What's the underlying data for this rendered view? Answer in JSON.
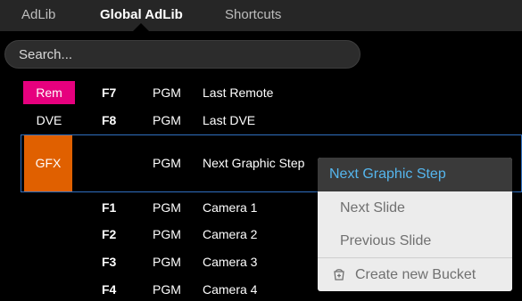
{
  "tabs": [
    {
      "label": "AdLib",
      "active": false
    },
    {
      "label": "Global AdLib",
      "active": true
    },
    {
      "label": "Shortcuts",
      "active": false
    }
  ],
  "search": {
    "placeholder": "Search...",
    "value": ""
  },
  "rows": [
    {
      "tag": "Rem",
      "tag_color": "#e6007e",
      "hotkey": "F7",
      "source": "PGM",
      "name": "Last Remote"
    },
    {
      "tag": "DVE",
      "tag_color": "",
      "hotkey": "F8",
      "source": "PGM",
      "name": "Last DVE"
    },
    {
      "tag": "GFX",
      "tag_color": "#e06000",
      "hotkey": "",
      "source": "PGM",
      "name": "Next Graphic Step",
      "selected": true
    },
    {
      "tag": "",
      "tag_color": "",
      "hotkey": "F1",
      "source": "PGM",
      "name": "Camera 1"
    },
    {
      "tag": "",
      "tag_color": "",
      "hotkey": "F2",
      "source": "PGM",
      "name": "Camera 2"
    },
    {
      "tag": "",
      "tag_color": "",
      "hotkey": "F3",
      "source": "PGM",
      "name": "Camera 3"
    },
    {
      "tag": "",
      "tag_color": "",
      "hotkey": "F4",
      "source": "PGM",
      "name": "Camera 4"
    }
  ],
  "context_menu": {
    "title": "Next Graphic Step",
    "items": [
      "Next Slide",
      "Previous Slide"
    ],
    "bucket_label": "Create new Bucket",
    "bucket_icon": "bucket-plus-icon"
  },
  "colors": {
    "selection_border": "#2f6fc0",
    "menu_title": "#55b6ee"
  }
}
